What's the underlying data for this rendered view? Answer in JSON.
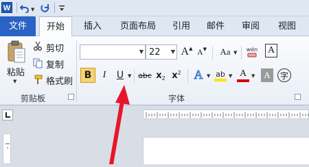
{
  "qat": {
    "word_icon_text": "W",
    "icons": [
      "word-app-icon",
      "undo-icon",
      "redo-icon",
      "customize-icon"
    ]
  },
  "tabs": [
    "文件",
    "开始",
    "插入",
    "页面布局",
    "引用",
    "邮件",
    "审阅",
    "视图"
  ],
  "clipboard": {
    "paste": "粘贴",
    "cut": "剪切",
    "copy": "复制",
    "format_painter": "格式刷",
    "group_label": "剪贴板"
  },
  "font": {
    "font_name_value": "",
    "font_size_value": "22",
    "grow_glyph": "A",
    "shrink_glyph": "A",
    "change_case_glyph": "Aa",
    "clear_format_glyph": "wén",
    "char_border_glyph": "A",
    "bold": "B",
    "italic": "I",
    "underline": "U",
    "strike": "abc",
    "sub": "x",
    "sub_suffix": "2",
    "sup": "x",
    "sup_suffix": "2",
    "text_effect": "A",
    "highlight": "ab",
    "font_color": "A",
    "char_shading": "A",
    "enclose": "字",
    "group_label": "字体"
  },
  "colors": {
    "file_tab": "#2a63c5",
    "highlight": "#f6e600",
    "font_color_bar": "#d40000",
    "bold_active": "#f7d36f",
    "arrow": "#e8162b"
  }
}
